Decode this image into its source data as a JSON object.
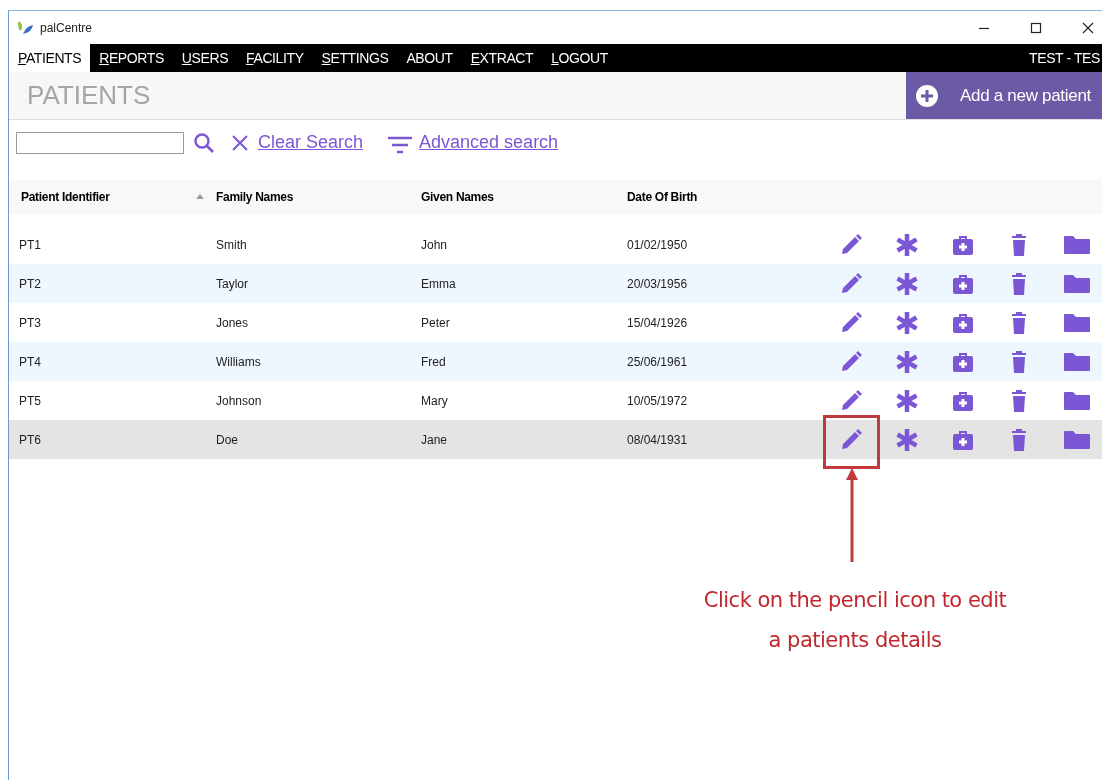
{
  "window": {
    "title": "palCentre"
  },
  "menu": [
    {
      "label": "PATIENTS",
      "underline_first": true,
      "selected": true
    },
    {
      "label": "REPORTS",
      "underline_first": true,
      "selected": false
    },
    {
      "label": "USERS",
      "underline_first": true,
      "selected": false
    },
    {
      "label": "FACILITY",
      "underline_first": true,
      "selected": false
    },
    {
      "label": "SETTINGS",
      "underline_first": true,
      "selected": false
    },
    {
      "label": "ABOUT",
      "underline_first": false,
      "selected": false
    },
    {
      "label": "EXTRACT",
      "underline_first": true,
      "selected": false
    },
    {
      "label": "LOGOUT",
      "underline_first": true,
      "selected": false
    }
  ],
  "user": "TEST - TES",
  "page_title": "PATIENTS",
  "add_button": "Add a new patient",
  "clear_search": "Clear Search",
  "advanced_search": "Advanced search",
  "table": {
    "columns": [
      {
        "label": "Patient Identifier",
        "sorted": true
      },
      {
        "label": "Family Names",
        "sorted": false
      },
      {
        "label": "Given Names",
        "sorted": false
      },
      {
        "label": "Date Of Birth",
        "sorted": false
      }
    ],
    "rows": [
      {
        "cells": [
          "PT1",
          "Smith",
          "John",
          "01/02/1950"
        ],
        "selected": false
      },
      {
        "cells": [
          "PT2",
          "Taylor",
          "Emma",
          "20/03/1956"
        ],
        "selected": false
      },
      {
        "cells": [
          "PT3",
          "Jones",
          "Peter",
          "15/04/1926"
        ],
        "selected": false
      },
      {
        "cells": [
          "PT4",
          "Williams",
          "Fred",
          "25/06/1961"
        ],
        "selected": false
      },
      {
        "cells": [
          "PT5",
          "Johnson",
          "Mary",
          "10/05/1972"
        ],
        "selected": false
      },
      {
        "cells": [
          "PT6",
          "Doe",
          "Jane",
          "08/04/1931"
        ],
        "selected": true
      }
    ]
  },
  "annotation": "Click on the pencil icon to edit a patients details"
}
